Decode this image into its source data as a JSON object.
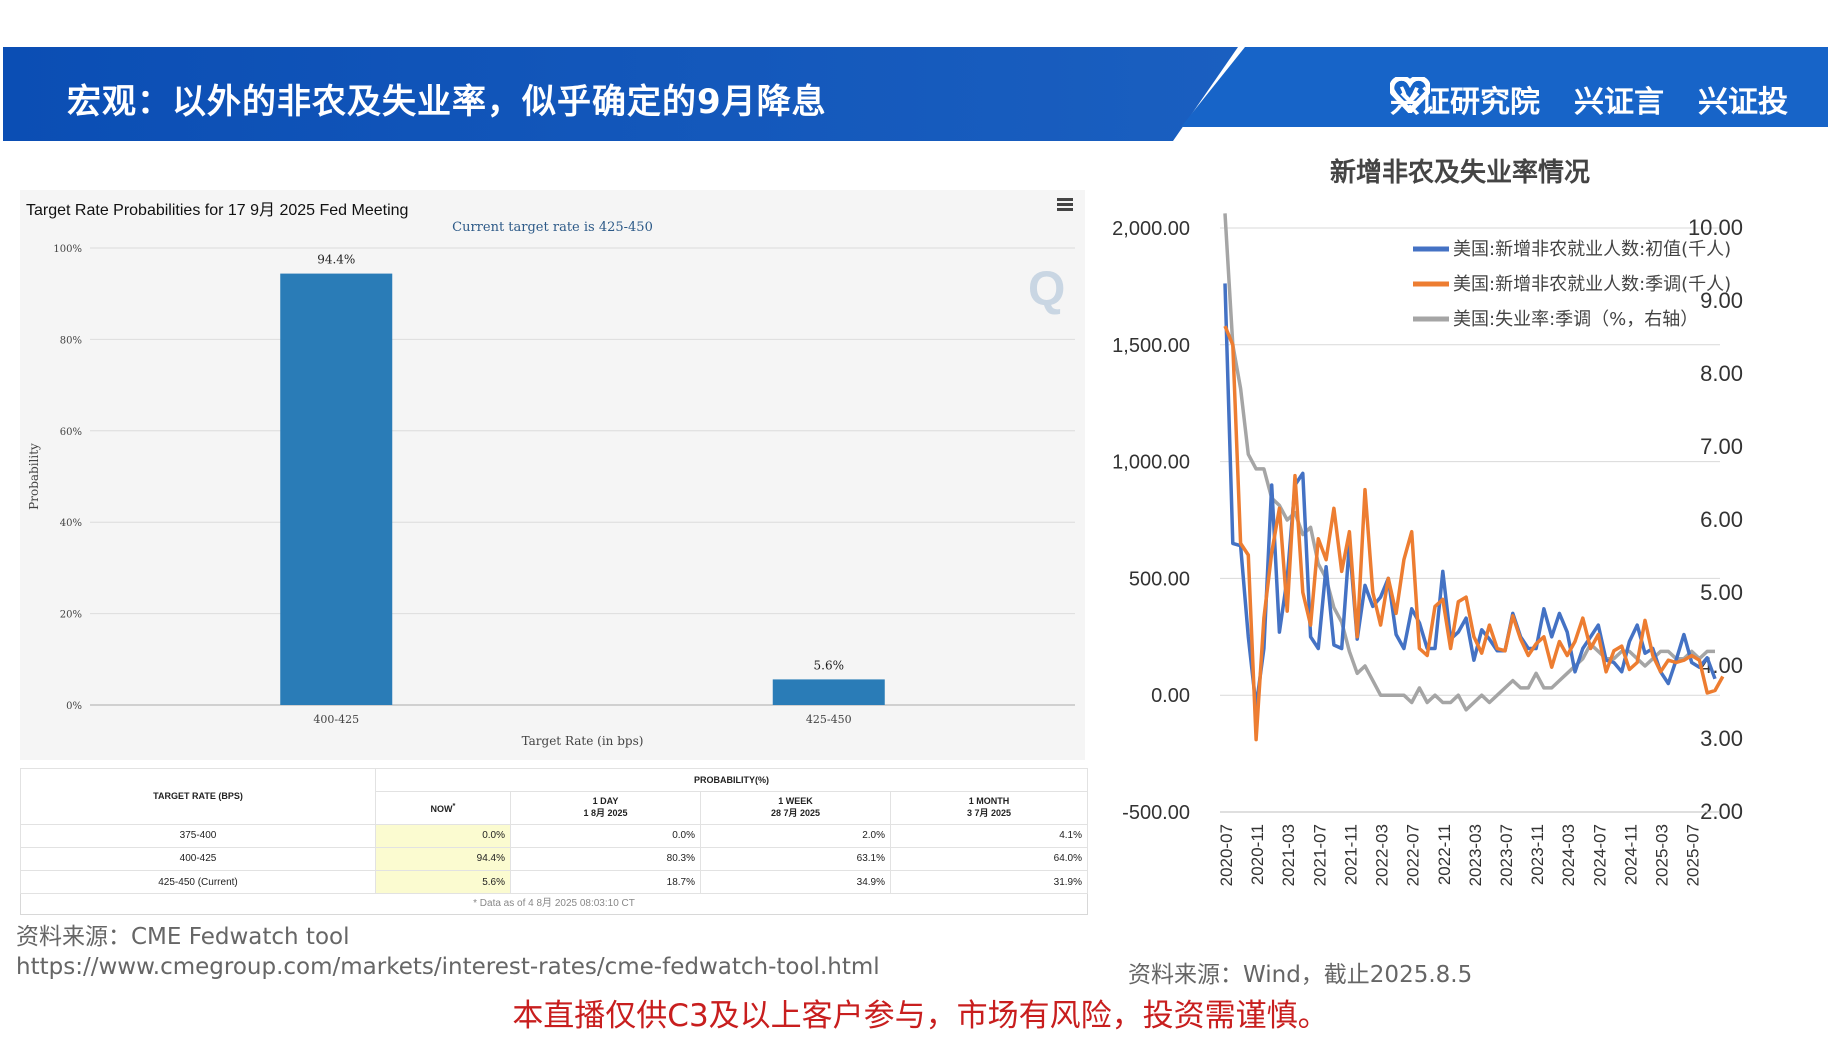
{
  "banner": {
    "title": "宏观：以外的非农及失业率，似乎确定的9月降息",
    "logos": [
      "兴证研究院",
      "兴证言",
      "兴证投"
    ],
    "color": "#0e4fb2"
  },
  "fedwatch": {
    "title": "Target Rate Probabilities for 17 9月 2025 Fed Meeting",
    "subtitle": "Current target rate is 425-450",
    "watermark": "Q",
    "menu_icon": "hamburger-menu-icon",
    "table": {
      "col_target": "TARGET RATE (BPS)",
      "col_probability": "PROBABILITY(%)",
      "sub_now": "NOW",
      "sub_now_sup": "*",
      "sub_1day_a": "1 DAY",
      "sub_1day_b": "1 8月 2025",
      "sub_1week_a": "1 WEEK",
      "sub_1week_b": "28 7月 2025",
      "sub_1month_a": "1 MONTH",
      "sub_1month_b": "3 7月 2025",
      "rows": [
        {
          "rate": "375-400",
          "now": "0.0%",
          "day": "0.0%",
          "week": "2.0%",
          "month": "4.1%"
        },
        {
          "rate": "400-425",
          "now": "94.4%",
          "day": "80.3%",
          "week": "63.1%",
          "month": "64.0%"
        },
        {
          "rate": "425-450 (Current)",
          "now": "5.6%",
          "day": "18.7%",
          "week": "34.9%",
          "month": "31.9%"
        }
      ],
      "note": "* Data as of 4 8月 2025 08:03:10 CT"
    }
  },
  "source_left": {
    "line1": "资料来源：CME Fedwatch tool",
    "line2": "https://www.cmegroup.com/markets/interest-rates/cme-fedwatch-tool.html"
  },
  "source_right": "资料来源：Wind，截止2025.8.5",
  "disclaimer": "本直播仅供C3及以上客户参与，市场有风险，投资需谨慎。",
  "chart_data": [
    {
      "type": "bar",
      "title": "Target Rate Probabilities for 17 9月 2025 Fed Meeting",
      "subtitle": "Current target rate is 425-450",
      "xlabel": "Target Rate (in bps)",
      "ylabel": "Probability",
      "categories": [
        "400-425",
        "425-450"
      ],
      "values": [
        94.4,
        5.6
      ],
      "value_labels": [
        "94.4%",
        "5.6%"
      ],
      "ylim": [
        0,
        100
      ],
      "yticks": [
        "0%",
        "20%",
        "40%",
        "60%",
        "80%",
        "100%"
      ],
      "grid": true,
      "color": "#2a7cb7"
    },
    {
      "type": "line",
      "title": "新增非农及失业率情况",
      "x_start": "2020-07",
      "x_ticks": [
        "2020-07",
        "2020-11",
        "2021-03",
        "2021-07",
        "2021-11",
        "2022-03",
        "2022-07",
        "2022-11",
        "2023-03",
        "2023-07",
        "2023-11",
        "2024-03",
        "2024-07",
        "2024-11",
        "2025-03",
        "2025-07"
      ],
      "y_left": {
        "range": [
          -500,
          2000
        ],
        "ticks": [
          "-500.00",
          "0.00",
          "500.00",
          "1,000.00",
          "1,500.00",
          "2,000.00"
        ]
      },
      "y_right": {
        "range": [
          2,
          10
        ],
        "ticks": [
          "2.00",
          "3.00",
          "4.00",
          "5.00",
          "6.00",
          "7.00",
          "8.00",
          "9.00",
          "10.00"
        ]
      },
      "legend_position": "top-right",
      "grid": true,
      "series": [
        {
          "name": "美国:新增非农就业人数:初值(千人)",
          "axis": "left",
          "color": "#4472c4",
          "values": [
            1763,
            650,
            640,
            250,
            -50,
            200,
            900,
            270,
            500,
            900,
            950,
            250,
            200,
            550,
            215,
            200,
            650,
            240,
            470,
            380,
            420,
            500,
            260,
            200,
            370,
            310,
            200,
            200,
            530,
            240,
            270,
            330,
            150,
            280,
            240,
            190,
            190,
            350,
            250,
            200,
            200,
            370,
            250,
            350,
            270,
            100,
            200,
            250,
            300,
            150,
            140,
            100,
            230,
            300,
            180,
            200,
            100,
            50,
            150,
            260,
            140,
            120,
            160,
            70
          ]
        },
        {
          "name": "美国:新增非农就业人数:季调(千人)",
          "axis": "left",
          "color": "#ed7d31",
          "values": [
            1580,
            1500,
            650,
            600,
            -190,
            330,
            610,
            800,
            360,
            940,
            440,
            300,
            670,
            580,
            800,
            530,
            700,
            250,
            880,
            440,
            300,
            500,
            350,
            580,
            700,
            200,
            170,
            380,
            410,
            200,
            400,
            420,
            250,
            180,
            300,
            200,
            190,
            340,
            240,
            170,
            220,
            250,
            120,
            230,
            170,
            230,
            330,
            200,
            260,
            100,
            190,
            210,
            110,
            140,
            320,
            170,
            100,
            150,
            140,
            150,
            170,
            150,
            10,
            20,
            80
          ]
        },
        {
          "name": "美国:失业率:季调（%，右轴）",
          "axis": "right",
          "color": "#a5a5a5",
          "values": [
            10.2,
            8.4,
            7.8,
            6.9,
            6.7,
            6.7,
            6.3,
            6.2,
            6.0,
            6.1,
            5.8,
            5.9,
            5.4,
            5.2,
            4.8,
            4.6,
            4.2,
            3.9,
            4.0,
            3.8,
            3.6,
            3.6,
            3.6,
            3.6,
            3.5,
            3.7,
            3.5,
            3.6,
            3.5,
            3.5,
            3.6,
            3.4,
            3.5,
            3.6,
            3.5,
            3.6,
            3.7,
            3.8,
            3.7,
            3.7,
            3.9,
            3.7,
            3.7,
            3.8,
            3.9,
            4.0,
            4.1,
            4.3,
            4.2,
            4.1,
            4.1,
            4.2,
            4.2,
            4.1,
            4.0,
            4.1,
            4.2,
            4.2,
            4.1,
            4.1,
            4.2,
            4.1,
            4.2,
            4.2
          ]
        }
      ]
    }
  ]
}
